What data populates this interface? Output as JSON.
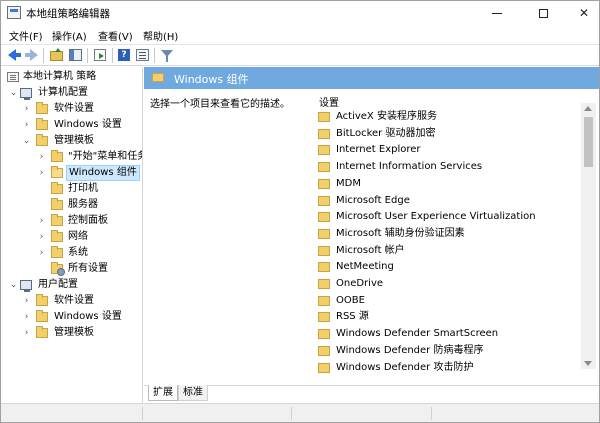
{
  "window": {
    "title": "本地组策略编辑器"
  },
  "title_controls": {
    "minimize": "minimize",
    "maximize": "maximize",
    "close": "✕"
  },
  "menu": [
    "文件(F)",
    "操作(A)",
    "查看(V)",
    "帮助(H)"
  ],
  "toolbar": {
    "buttons": [
      "back-icon",
      "forward-icon",
      "up-folder-icon",
      "show-tree-icon",
      "export-list-icon",
      "help-icon",
      "properties-icon",
      "filter-icon"
    ],
    "help_glyph": "?"
  },
  "tree": [
    {
      "label": "本地计算机 策略",
      "level": 0,
      "chevron": "",
      "icon": "policy"
    },
    {
      "label": "计算机配置",
      "level": 1,
      "chevron": "⌄",
      "icon": "pc"
    },
    {
      "label": "软件设置",
      "level": 2,
      "chevron": "›",
      "icon": "folder"
    },
    {
      "label": "Windows 设置",
      "level": 2,
      "chevron": "›",
      "icon": "folder"
    },
    {
      "label": "管理模板",
      "level": 2,
      "chevron": "⌄",
      "icon": "folder"
    },
    {
      "label": "\"开始\"菜单和任务",
      "level": 3,
      "chevron": "›",
      "icon": "folder"
    },
    {
      "label": "Windows 组件",
      "level": 3,
      "chevron": "›",
      "icon": "folder-open",
      "selected": true
    },
    {
      "label": "打印机",
      "level": 3,
      "chevron": "",
      "icon": "folder"
    },
    {
      "label": "服务器",
      "level": 3,
      "chevron": "",
      "icon": "folder"
    },
    {
      "label": "控制面板",
      "level": 3,
      "chevron": "›",
      "icon": "folder"
    },
    {
      "label": "网络",
      "level": 3,
      "chevron": "›",
      "icon": "folder"
    },
    {
      "label": "系统",
      "level": 3,
      "chevron": "›",
      "icon": "folder"
    },
    {
      "label": "所有设置",
      "level": 3,
      "chevron": "",
      "icon": "folder-gear"
    },
    {
      "label": "用户配置",
      "level": 1,
      "chevron": "⌄",
      "icon": "pc"
    },
    {
      "label": "软件设置",
      "level": 2,
      "chevron": "›",
      "icon": "folder"
    },
    {
      "label": "Windows 设置",
      "level": 2,
      "chevron": "›",
      "icon": "folder"
    },
    {
      "label": "管理模板",
      "level": 2,
      "chevron": "›",
      "icon": "folder"
    }
  ],
  "content": {
    "header": "Windows 组件",
    "description": "选择一个项目来查看它的描述。",
    "column_header": "设置",
    "items": [
      "ActiveX 安装程序服务",
      "BitLocker 驱动器加密",
      "Internet Explorer",
      "Internet Information Services",
      "MDM",
      "Microsoft Edge",
      "Microsoft User Experience Virtualization",
      "Microsoft 辅助身份验证因素",
      "Microsoft 帐户",
      "NetMeeting",
      "OneDrive",
      "OOBE",
      "RSS 源",
      "Windows Defender SmartScreen",
      "Windows Defender 防病毒程序",
      "Windows Defender 攻击防护"
    ]
  },
  "tabs": [
    {
      "label": "扩展",
      "active": true
    },
    {
      "label": "标准",
      "active": false
    }
  ],
  "colors": {
    "header_blue": "#6fa9e0",
    "selection": "#cce8ff",
    "folder": "#f3cf6a"
  }
}
